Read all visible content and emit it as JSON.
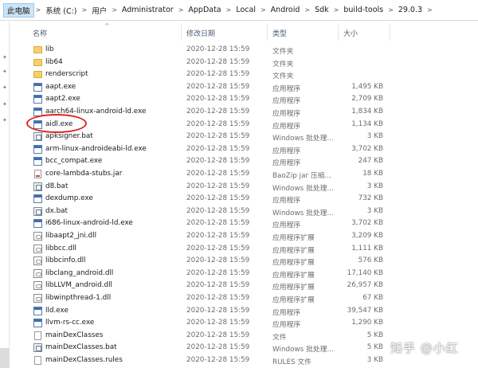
{
  "breadcrumb": [
    "此电脑",
    "系统 (C:)",
    "用户",
    "Administrator",
    "AppData",
    "Local",
    "Android",
    "Sdk",
    "build-tools",
    "29.0.3"
  ],
  "columns": {
    "name": "名称",
    "date": "修改日期",
    "type": "类型",
    "size": "大小"
  },
  "files": [
    {
      "name": "lib",
      "date": "2020-12-28 15:59",
      "type": "文件夹",
      "size": "",
      "icon": "folder-icon"
    },
    {
      "name": "lib64",
      "date": "2020-12-28 15:59",
      "type": "文件夹",
      "size": "",
      "icon": "folder-icon"
    },
    {
      "name": "renderscript",
      "date": "2020-12-28 15:59",
      "type": "文件夹",
      "size": "",
      "icon": "folder-icon"
    },
    {
      "name": "aapt.exe",
      "date": "2020-12-28 15:59",
      "type": "应用程序",
      "size": "1,495 KB",
      "icon": "exe-icon"
    },
    {
      "name": "aapt2.exe",
      "date": "2020-12-28 15:59",
      "type": "应用程序",
      "size": "2,709 KB",
      "icon": "exe-icon"
    },
    {
      "name": "aarch64-linux-android-ld.exe",
      "date": "2020-12-28 15:59",
      "type": "应用程序",
      "size": "1,834 KB",
      "icon": "exe-icon"
    },
    {
      "name": "aidl.exe",
      "date": "2020-12-28 15:59",
      "type": "应用程序",
      "size": "1,134 KB",
      "icon": "exe-icon"
    },
    {
      "name": "apksigner.bat",
      "date": "2020-12-28 15:59",
      "type": "Windows 批处理...",
      "size": "3 KB",
      "icon": "bat-icon"
    },
    {
      "name": "arm-linux-androideabi-ld.exe",
      "date": "2020-12-28 15:59",
      "type": "应用程序",
      "size": "3,702 KB",
      "icon": "exe-icon"
    },
    {
      "name": "bcc_compat.exe",
      "date": "2020-12-28 15:59",
      "type": "应用程序",
      "size": "247 KB",
      "icon": "exe-icon"
    },
    {
      "name": "core-lambda-stubs.jar",
      "date": "2020-12-28 15:59",
      "type": "BaoZip jar 压缩...",
      "size": "18 KB",
      "icon": "jar-icon"
    },
    {
      "name": "d8.bat",
      "date": "2020-12-28 15:59",
      "type": "Windows 批处理...",
      "size": "3 KB",
      "icon": "bat-icon"
    },
    {
      "name": "dexdump.exe",
      "date": "2020-12-28 15:59",
      "type": "应用程序",
      "size": "732 KB",
      "icon": "exe-icon"
    },
    {
      "name": "dx.bat",
      "date": "2020-12-28 15:59",
      "type": "Windows 批处理...",
      "size": "3 KB",
      "icon": "bat-icon"
    },
    {
      "name": "i686-linux-android-ld.exe",
      "date": "2020-12-28 15:59",
      "type": "应用程序",
      "size": "3,702 KB",
      "icon": "exe-icon"
    },
    {
      "name": "libaapt2_jni.dll",
      "date": "2020-12-28 15:59",
      "type": "应用程序扩展",
      "size": "3,209 KB",
      "icon": "dll-icon"
    },
    {
      "name": "libbcc.dll",
      "date": "2020-12-28 15:59",
      "type": "应用程序扩展",
      "size": "1,111 KB",
      "icon": "dll-icon"
    },
    {
      "name": "libbcinfo.dll",
      "date": "2020-12-28 15:59",
      "type": "应用程序扩展",
      "size": "576 KB",
      "icon": "dll-icon"
    },
    {
      "name": "libclang_android.dll",
      "date": "2020-12-28 15:59",
      "type": "应用程序扩展",
      "size": "17,140 KB",
      "icon": "dll-icon"
    },
    {
      "name": "libLLVM_android.dll",
      "date": "2020-12-28 15:59",
      "type": "应用程序扩展",
      "size": "26,957 KB",
      "icon": "dll-icon"
    },
    {
      "name": "libwinpthread-1.dll",
      "date": "2020-12-28 15:59",
      "type": "应用程序扩展",
      "size": "67 KB",
      "icon": "dll-icon"
    },
    {
      "name": "lld.exe",
      "date": "2020-12-28 15:59",
      "type": "应用程序",
      "size": "39,547 KB",
      "icon": "exe-icon"
    },
    {
      "name": "llvm-rs-cc.exe",
      "date": "2020-12-28 15:59",
      "type": "应用程序",
      "size": "1,290 KB",
      "icon": "exe-icon"
    },
    {
      "name": "mainDexClasses",
      "date": "2020-12-28 15:59",
      "type": "文件",
      "size": "5 KB",
      "icon": "file-icon"
    },
    {
      "name": "mainDexClasses.bat",
      "date": "2020-12-28 15:59",
      "type": "Windows 批处理...",
      "size": "5 KB",
      "icon": "bat-icon"
    },
    {
      "name": "mainDexClasses.rules",
      "date": "2020-12-28 15:59",
      "type": "RULES 文件",
      "size": "3 KB",
      "icon": "file-icon"
    }
  ],
  "watermark": "知乎 @小红",
  "colors": {
    "annotation": "#d9261c",
    "header_text": "#4c607a",
    "folder": "#f7d06b",
    "selected_crumb": "#cce4f7"
  }
}
